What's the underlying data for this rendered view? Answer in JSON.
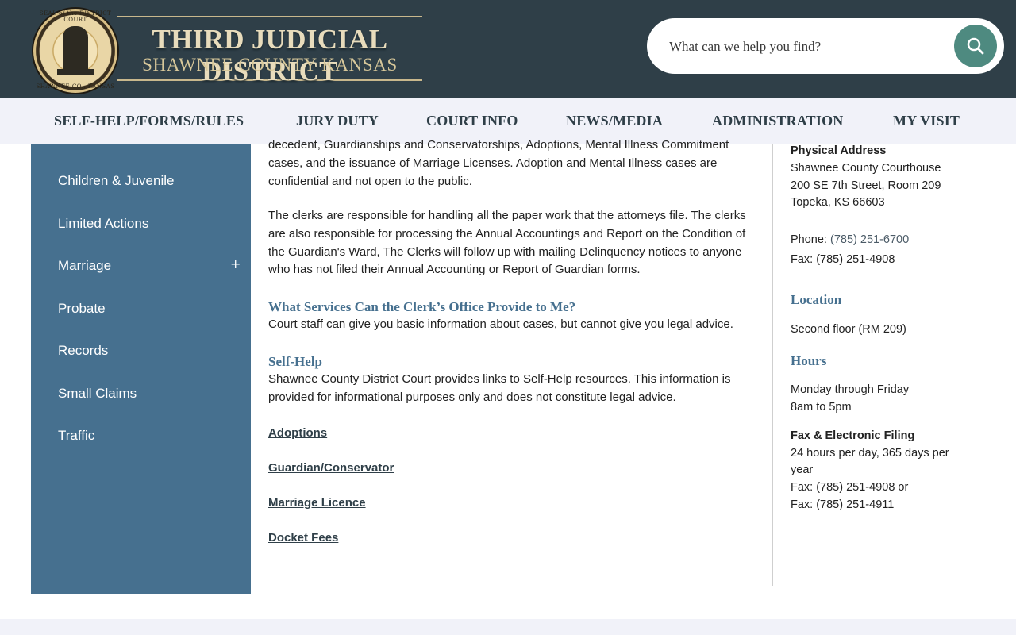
{
  "header": {
    "title_line1": "THIRD JUDICIAL DISTRICT",
    "title_line2": "SHAWNEE COUNTY KANSAS",
    "seal_top": "SEAL of the DISTRICT COURT",
    "seal_bottom": "SHAWNEE CO., KANSAS",
    "search_placeholder": "What can we help you find?"
  },
  "nav": {
    "items": [
      "SELF-HELP/FORMS/RULES",
      "JURY DUTY",
      "COURT INFO",
      "NEWS/MEDIA",
      "ADMINISTRATION",
      "MY VISIT"
    ]
  },
  "sidebar": {
    "items": [
      "Children & Juvenile",
      "Limited Actions",
      "Marriage",
      "Probate",
      "Records",
      "Small Claims",
      "Traffic"
    ],
    "expand_symbol": "+"
  },
  "main": {
    "para1_line1": "decedent, Guardianships and Conservatorships, Adoptions, Mental Illness Commitment",
    "para1_line2": "cases, and the issuance of Marriage Licenses. Adoption and Mental Illness cases are",
    "para1_line3": "confidential and not open to the public.",
    "para2": "The clerks are responsible for handling all the paper work that the attorneys file. The clerks are also responsible for processing the Annual Accountings and Report on the Condition of the Guardian's Ward, The Clerks will follow up with mailing Delinquency notices to anyone who has not filed their Annual Accounting or Report of Guardian forms.",
    "services_heading": "What Services Can the Clerk’s Office Provide to Me?",
    "services_text": "Court staff can give you basic information about cases, but cannot give you legal advice.",
    "selfhelp_heading": "Self-Help",
    "selfhelp_text": "Shawnee County District Court provides links to Self-Help resources.  This information is provided for informational purposes only and does not constitute legal advice.",
    "links": [
      "Adoptions",
      "Guardian/Conservator",
      "Marriage Licence",
      "Docket Fees"
    ]
  },
  "contact": {
    "physical_address_label": "Physical Address",
    "address_line1": "Shawnee County Courthouse",
    "address_line2": "200 SE 7th Street, Room 209",
    "address_line3": "Topeka, KS 66603",
    "phone_label": "Phone: ",
    "phone": "(785) 251-6700",
    "fax": "Fax: (785) 251-4908",
    "location_heading": "Location",
    "location_text": "Second floor (RM 209)",
    "hours_heading": "Hours",
    "hours_line1": "Monday through Friday",
    "hours_line2": "8am to 5pm",
    "filing_label": "Fax & Electronic Filing",
    "filing_line1": "24 hours per day, 365 days per",
    "filing_line2": "year",
    "filing_fax1": "Fax: (785) 251-4908 or",
    "filing_fax2": "Fax: (785) 251-4911"
  },
  "colors": {
    "header_bg": "#2f3f48",
    "sidebar_bg": "#46708f",
    "accent": "#4e8a80",
    "nav_bg": "#f1f2f9"
  }
}
